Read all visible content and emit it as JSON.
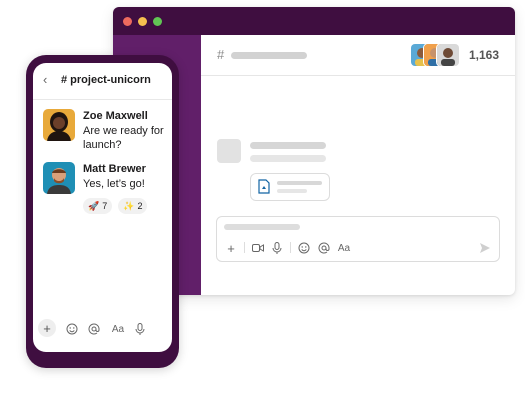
{
  "desktop": {
    "channel_hash": "#",
    "member_count": "1,163",
    "member_avatars": [
      "member-avatar-1",
      "member-avatar-2",
      "member-avatar-3"
    ],
    "composer_tools": {
      "plus": "+",
      "format": "Aa"
    }
  },
  "mobile": {
    "back_icon": "‹",
    "channel_title": "# project-unicorn",
    "messages": [
      {
        "name": "Zoe Maxwell",
        "text": "Are we ready for launch?",
        "avatar": "zoe-avatar"
      },
      {
        "name": "Matt Brewer",
        "text": "Yes, let’s go!",
        "avatar": "matt-avatar",
        "reactions": [
          {
            "emoji": "🚀",
            "count": "7"
          },
          {
            "emoji": "✨",
            "count": "2"
          }
        ]
      }
    ],
    "composer_tools": {
      "plus": "+",
      "format": "Aa"
    }
  },
  "colors": {
    "aubergine": "#3f0e40",
    "sidebar_purple": "#611f69",
    "traffic_red": "#ed6a5e",
    "traffic_yellow": "#f5bf4f",
    "traffic_green": "#61c554"
  }
}
